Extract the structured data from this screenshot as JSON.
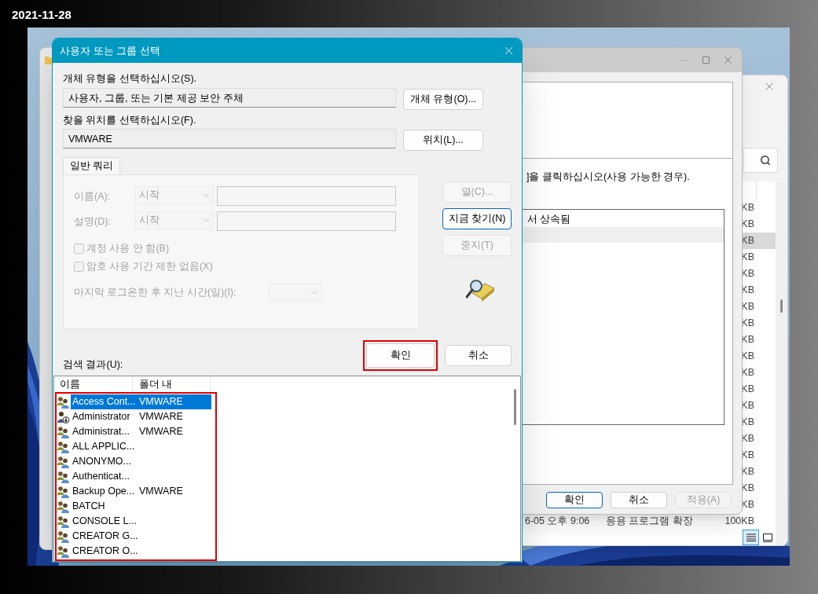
{
  "caption": {
    "text": "2021-11-28"
  },
  "explorer_window": {
    "rows": [
      {
        "size": "KB",
        "selected": false
      },
      {
        "size": "KB",
        "selected": false
      },
      {
        "size": "KB",
        "selected": true
      },
      {
        "size": "KB",
        "selected": false
      },
      {
        "size": "KB",
        "selected": false
      },
      {
        "size": "KB",
        "selected": false
      },
      {
        "size": "KB",
        "selected": false
      },
      {
        "size": "KB",
        "selected": false
      },
      {
        "size": "KB",
        "selected": false
      },
      {
        "size": "KB",
        "selected": false
      },
      {
        "size": "KB",
        "selected": false
      },
      {
        "size": "KB",
        "selected": false
      },
      {
        "size": "KB",
        "selected": false
      },
      {
        "size": "KB",
        "selected": false
      },
      {
        "size": "KB",
        "selected": false
      },
      {
        "size": "KB",
        "selected": false
      },
      {
        "size": "KB",
        "selected": false
      },
      {
        "size": "KB",
        "selected": false
      },
      {
        "size": "KB",
        "selected": false
      },
      {
        "modified": "6-05 오후 9:06",
        "type": "응용 프로그램 확장",
        "size": "100KB",
        "selected": false
      }
    ],
    "view_buttons": [
      {
        "kind": "details",
        "selected": true
      },
      {
        "kind": "tiles",
        "selected": false
      }
    ]
  },
  "properties_window": {
    "instruction": "]을 클릭하십시오(사용 가능한 경우).",
    "list_rows": [
      {
        "text": "서 상속됨",
        "selected": false
      },
      {
        "selected": true
      }
    ],
    "buttons": [
      {
        "label": "확인",
        "default": true,
        "disabled": false
      },
      {
        "label": "취소",
        "default": false,
        "disabled": false
      },
      {
        "label": "적용(A)",
        "default": false,
        "disabled": true
      }
    ]
  },
  "dialog": {
    "title": "사용자 또는 그룹 선택",
    "object_type": {
      "label": "개체 유형을 선택하십시오(S).",
      "value": "사용자, 그룹, 또는 기본 제공 보안 주체",
      "button": "개체 유형(O)..."
    },
    "location": {
      "label": "찾을 위치를 선택하십시오(F).",
      "value": "VMWARE",
      "button": "위치(L)..."
    },
    "tabs": [
      {
        "label": "일반 쿼리",
        "selected": true
      }
    ],
    "query": {
      "fields": [
        {
          "label": "이름(A):",
          "mode": "시작",
          "disabled": true
        },
        {
          "label": "설명(D):",
          "mode": "시작",
          "disabled": true
        }
      ],
      "checkboxes": [
        {
          "label": "계정 사용 안 함(B)",
          "checked": false,
          "disabled": true
        },
        {
          "label": "암호 사용 기간 제한 없음(X)",
          "checked": false,
          "disabled": true
        }
      ],
      "days_since_logon": {
        "label": "마지막 로그온한 후 지난 시간(일)(I):",
        "disabled": true
      }
    },
    "side_buttons": [
      {
        "label": "열(C)...",
        "default": false,
        "disabled": true
      },
      {
        "label": "지금 찾기(N)",
        "default": true,
        "disabled": false
      },
      {
        "label": "중지(T)",
        "default": false,
        "disabled": true
      }
    ],
    "results_label": "검색 결과(U):",
    "buttons": [
      {
        "label": "확인",
        "highlighted": true
      },
      {
        "label": "취소",
        "highlighted": false
      }
    ],
    "results": {
      "highlighted": true,
      "columns": [
        "이름",
        "폴더 내"
      ],
      "rows": [
        {
          "name": "Access Cont...",
          "folder": "VMWARE",
          "kind": "group",
          "selected": true
        },
        {
          "name": "Administrator",
          "folder": "VMWARE",
          "kind": "user",
          "selected": false
        },
        {
          "name": "Administrat...",
          "folder": "VMWARE",
          "kind": "group",
          "selected": false
        },
        {
          "name": "ALL APPLIC...",
          "kind": "group",
          "selected": false
        },
        {
          "name": "ANONYMO...",
          "kind": "group",
          "selected": false
        },
        {
          "name": "Authenticat...",
          "kind": "group",
          "selected": false
        },
        {
          "name": "Backup Ope...",
          "folder": "VMWARE",
          "kind": "group",
          "selected": false
        },
        {
          "name": "BATCH",
          "kind": "group",
          "selected": false
        },
        {
          "name": "CONSOLE L...",
          "kind": "group",
          "selected": false
        },
        {
          "name": "CREATOR G...",
          "kind": "group",
          "selected": false
        },
        {
          "name": "CREATOR O...",
          "kind": "group",
          "selected": false
        }
      ]
    }
  }
}
